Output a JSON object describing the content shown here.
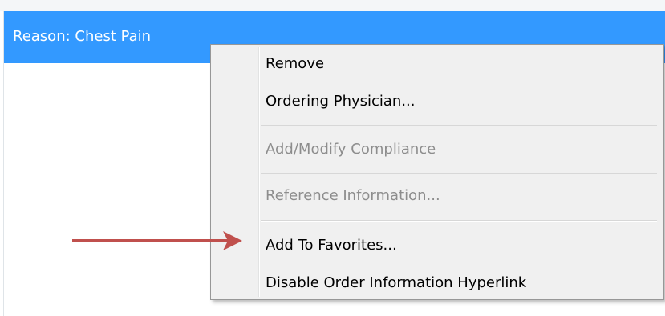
{
  "selected_row": {
    "label": "Reason: Chest Pain"
  },
  "context_menu": {
    "items": [
      {
        "label": "Remove",
        "enabled": true
      },
      {
        "label": "Ordering Physician...",
        "enabled": true
      },
      {
        "label": "Add/Modify Compliance",
        "enabled": false
      },
      {
        "label": "Reference Information...",
        "enabled": false
      },
      {
        "label": "Add To Favorites...",
        "enabled": true
      },
      {
        "label": "Disable Order Information Hyperlink",
        "enabled": true
      }
    ]
  },
  "annotation": {
    "arrow_color": "#c0504d",
    "points_to": "Add To Favorites..."
  },
  "colors": {
    "selection": "#3399ff",
    "menu_background": "#f0f0f0",
    "disabled_text": "#8d8d8d"
  }
}
